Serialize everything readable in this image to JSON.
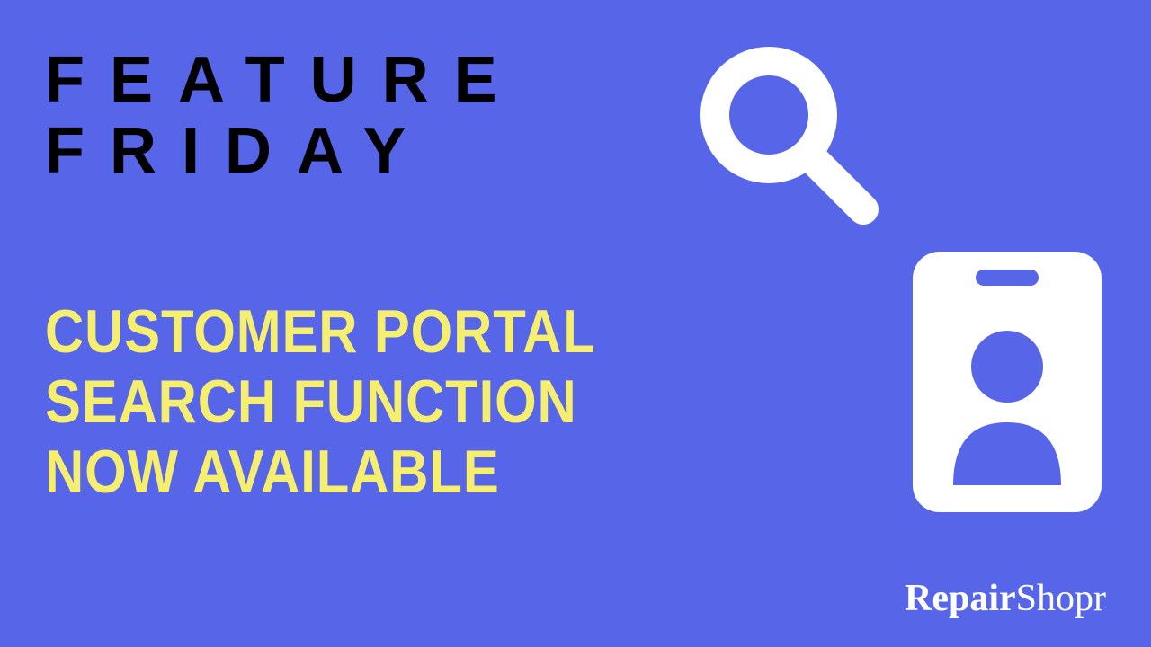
{
  "header": {
    "line1": "FEATURE",
    "line2": "FRIDAY"
  },
  "subtitle": {
    "line1": "CUSTOMER PORTAL",
    "line2": "SEARCH FUNCTION",
    "line3": "NOW AVAILABLE"
  },
  "brand": {
    "part1": "Repair",
    "part2": "Shopr"
  },
  "colors": {
    "background": "#5766e9",
    "accent": "#f6ee6f",
    "icon": "#ffffff"
  }
}
